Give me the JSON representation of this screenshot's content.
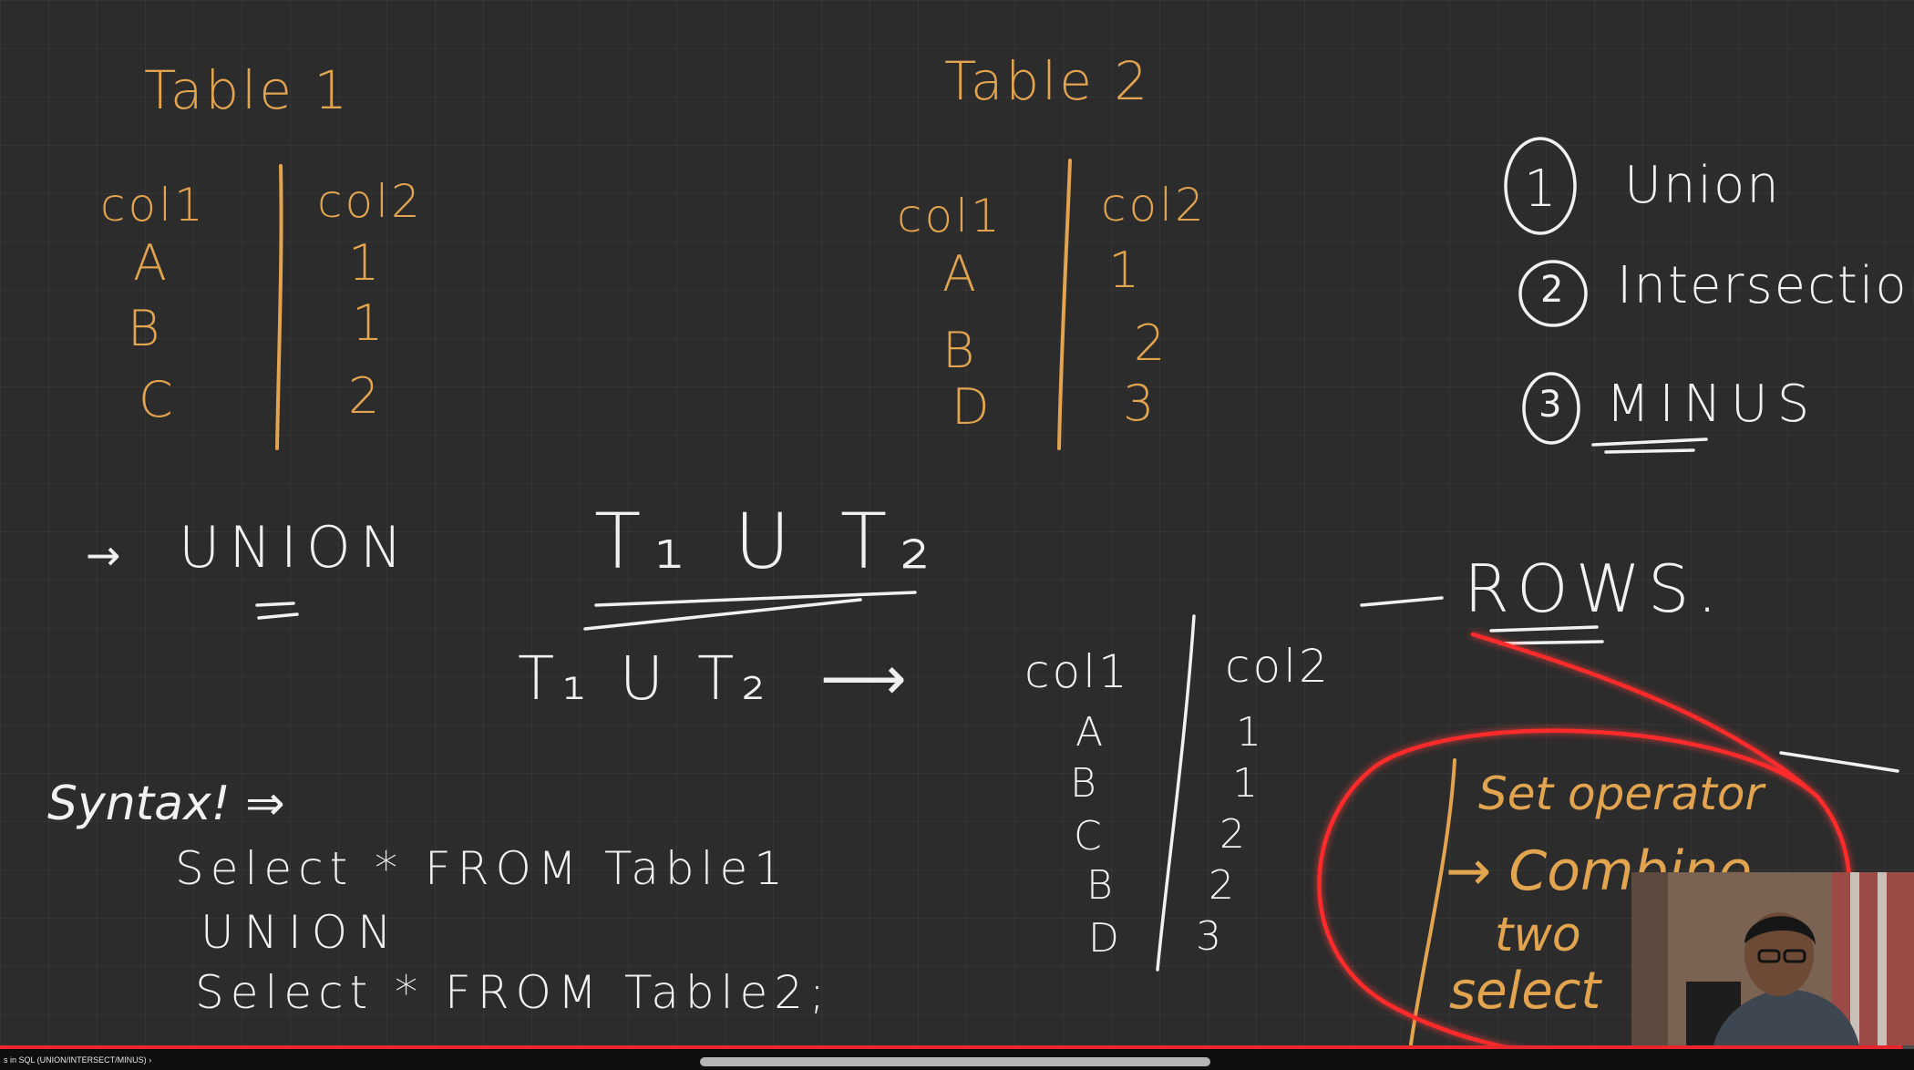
{
  "board": {
    "table1": {
      "title": "Table 1",
      "headers": [
        "col1",
        "col2"
      ],
      "rows": [
        [
          "A",
          "1"
        ],
        [
          "B",
          "1"
        ],
        [
          "C",
          "2"
        ]
      ]
    },
    "table2": {
      "title": "Table 2",
      "headers": [
        "col1",
        "col2"
      ],
      "rows": [
        [
          "A",
          "1"
        ],
        [
          "B",
          "2"
        ],
        [
          "D",
          "3"
        ]
      ]
    },
    "operations": [
      "Union",
      "Intersection",
      "MINUS"
    ],
    "operation_numbers": [
      "1",
      "2",
      "3"
    ],
    "union_label": "UNION",
    "union_arrow": "→",
    "formula": "T₁ U T₂",
    "formula_result": "T₁ U T₂",
    "result_arrow": "⟶",
    "rows_label": "ROWS.",
    "result_table": {
      "headers": [
        "col1",
        "col2"
      ],
      "rows": [
        [
          "A",
          "1"
        ],
        [
          "B",
          "1"
        ],
        [
          "C",
          "2"
        ],
        [
          "B",
          "2"
        ],
        [
          "D",
          "3"
        ]
      ]
    },
    "syntax_label": "Syntax! ⇒",
    "syntax_lines": [
      "Select * FROM Table1",
      "UNION",
      "Select * FROM Table2;"
    ],
    "note": {
      "title": "Set operator",
      "lines": [
        "→ Combine",
        "two",
        "select"
      ]
    },
    "colors": {
      "yellow_ink": "#e2a44f",
      "white_ink": "#f1f1f1",
      "red_ink": "#ff2a2a"
    }
  },
  "player": {
    "chapter_title": "s in SQL (UNION/INTERSECT/MINUS)",
    "chapter_chevron": "›",
    "progress": 0.994,
    "accent": "#e8262e"
  }
}
